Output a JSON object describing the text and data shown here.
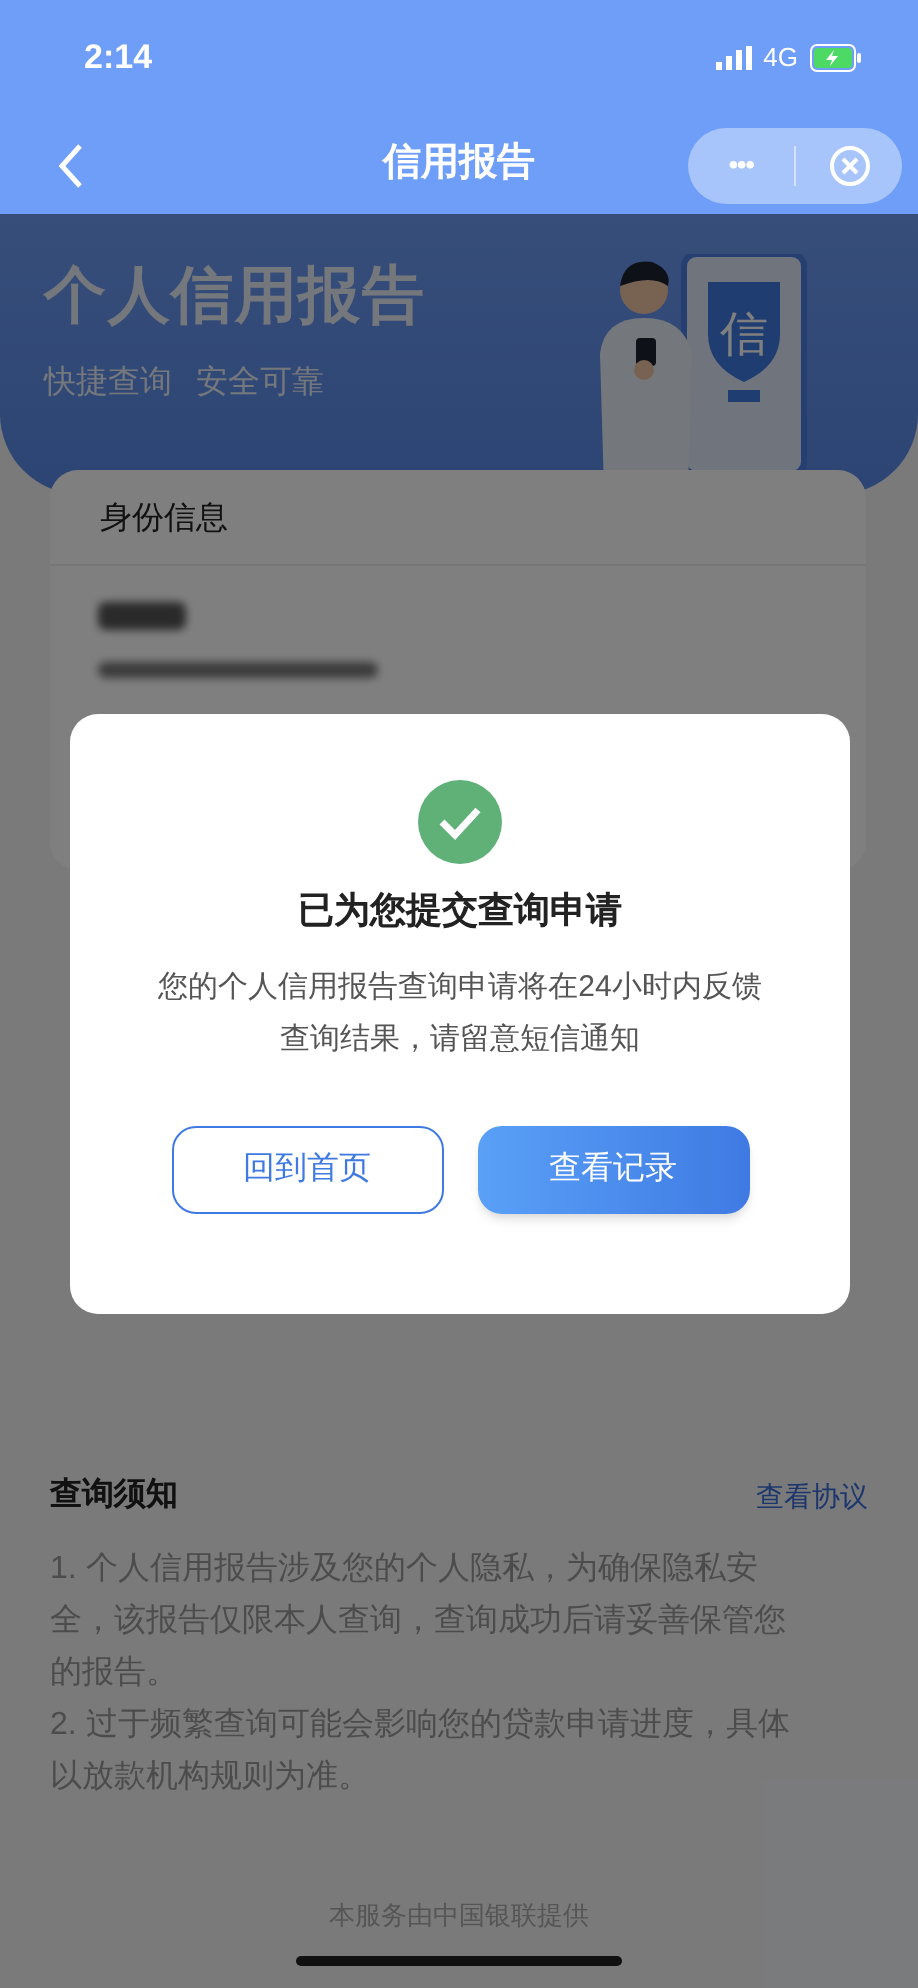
{
  "status_bar": {
    "time": "2:14",
    "network": "4G"
  },
  "nav_bar": {
    "title": "信用报告",
    "more": "•••"
  },
  "banner": {
    "title": "个人信用报告",
    "taglines": [
      "快捷查询",
      "安全可靠"
    ],
    "shield_text": "信"
  },
  "identity_card": {
    "title": "身份信息"
  },
  "notice": {
    "title": "查询须知",
    "link": "查看协议",
    "items": [
      "1. 个人信用报告涉及您的个人隐私，为确保隐私安全，该报告仅限本人查询，查询成功后请妥善保管您的报告。",
      "2. 过于频繁查询可能会影响您的贷款申请进度，具体以放款机构规则为准。"
    ]
  },
  "footer": "本服务由中国银联提供",
  "dialog": {
    "title": "已为您提交查询申请",
    "message": "您的个人信用报告查询申请将在24小时内反馈查询结果，请留意短信通知",
    "buttons": [
      {
        "label": "回到首页",
        "kind": "secondary"
      },
      {
        "label": "查看记录",
        "kind": "primary"
      }
    ]
  }
}
